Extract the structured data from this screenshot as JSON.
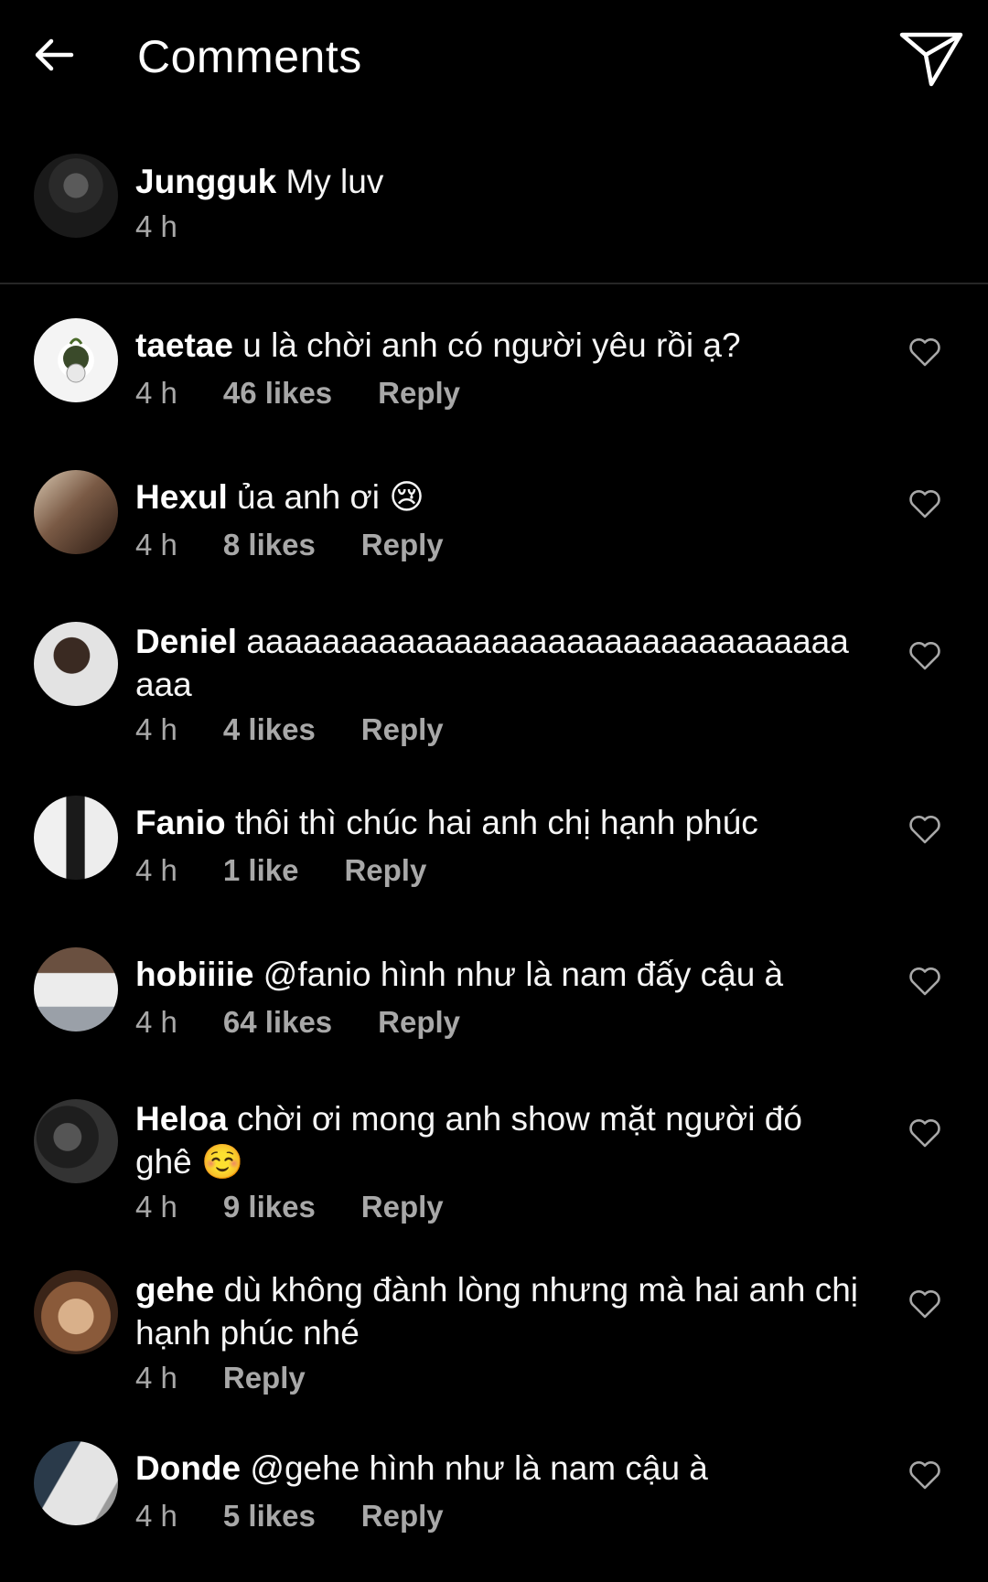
{
  "header": {
    "title": "Comments"
  },
  "caption": {
    "username": "Jungguk",
    "text": "My luv",
    "time": "4 h"
  },
  "comments": [
    {
      "username": "taetae",
      "text": "u là chời anh có người yêu rồi ạ?",
      "time": "4 h",
      "likes": "46 likes",
      "reply": "Reply",
      "avatar_color": "#f2f2f2"
    },
    {
      "username": "Hexul",
      "text": "ủa anh ơi 😢",
      "time": "4 h",
      "likes": "8 likes",
      "reply": "Reply",
      "avatar_color": "#7a5a45"
    },
    {
      "username": "Deniel",
      "text": "aaaaaaaaaaaaaaaaaaaaaaaaaaaaaaaaaaa",
      "time": "4 h",
      "likes": "4 likes",
      "reply": "Reply",
      "avatar_color": "#c9c9c9"
    },
    {
      "username": "Fanio",
      "text": "thôi thì chúc hai anh chị hạnh phúc",
      "time": "4 h",
      "likes": "1 like",
      "reply": "Reply",
      "avatar_color": "#e6e6e6"
    },
    {
      "username": "hobiiiie",
      "text": "@fanio hình như là nam đấy cậu à",
      "time": "4 h",
      "likes": "64 likes",
      "reply": "Reply",
      "avatar_color": "#cfc8c0"
    },
    {
      "username": "Heloa",
      "text": "chời ơi mong anh show mặt người đó ghê ☺️",
      "time": "4 h",
      "likes": "9 likes",
      "reply": "Reply",
      "avatar_color": "#2b2b2b"
    },
    {
      "username": "gehe",
      "text": "dù không đành lòng nhưng mà hai anh chị hạnh phúc nhé",
      "time": "4 h",
      "likes": "",
      "reply": "Reply",
      "avatar_color": "#8a5a3a"
    },
    {
      "username": "Donde",
      "text": "@gehe hình như là nam cậu à",
      "time": "4 h",
      "likes": "5 likes",
      "reply": "Reply",
      "avatar_color": "#bdbdbd"
    }
  ],
  "icons": {
    "back": "arrow-left-icon",
    "share": "paper-plane-icon",
    "like": "heart-outline-icon"
  },
  "colors": {
    "background": "#000000",
    "text": "#ffffff",
    "secondary": "#a8a8a8",
    "divider": "#262626"
  }
}
